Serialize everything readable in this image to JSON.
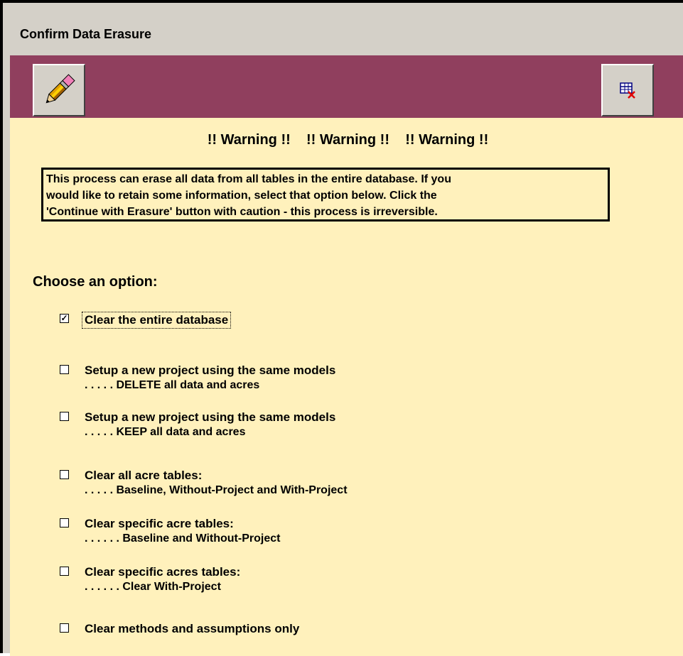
{
  "window": {
    "title": "Confirm Data Erasure"
  },
  "toolbar": {
    "erase_icon": "pencil-eraser-icon",
    "close_icon": "close-table-icon"
  },
  "content": {
    "warning": "!! Warning !!    !! Warning !!    !! Warning !!",
    "message": [
      "This process can erase all data from all tables in the entire database.  If you",
      "would like to retain some information, select that option below.  Click the",
      "'Continue with Erasure' button with caution - this process is irreversible."
    ],
    "heading": "Choose an option:",
    "options": [
      {
        "checked": true,
        "line1": "Clear the entire database",
        "line2": ""
      },
      {
        "checked": false,
        "line1": "Setup a new project using the same models",
        "line2": ". . . . . DELETE all data and acres"
      },
      {
        "checked": false,
        "line1": "Setup a new project using the same models",
        "line2": ". . . . . KEEP all data and acres"
      },
      {
        "checked": false,
        "line1": "Clear all acre tables:",
        "line2": ". . . . . Baseline, Without-Project and With-Project"
      },
      {
        "checked": false,
        "line1": "Clear specific acre tables:",
        "line2": ". . . . . . Baseline and Without-Project"
      },
      {
        "checked": false,
        "line1": "Clear specific acres tables:",
        "line2": ". . . . . . Clear With-Project"
      },
      {
        "checked": false,
        "line1": "Clear methods and assumptions only",
        "line2": ""
      }
    ]
  },
  "colors": {
    "toolbar": "#903f5e",
    "content": "#fff1bc",
    "chrome": "#d4d0c8"
  }
}
